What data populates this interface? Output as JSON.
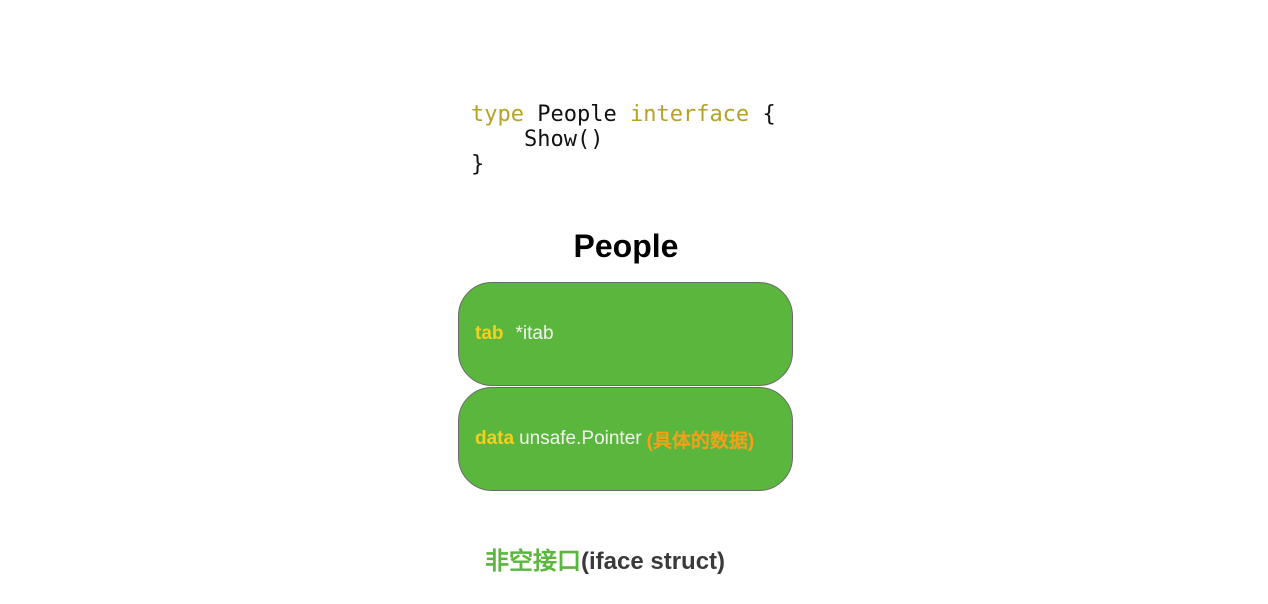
{
  "code": {
    "line1": {
      "kw1": "type",
      "name": "People",
      "kw2": "interface",
      "brace": "{"
    },
    "line2": {
      "text": "Show()"
    },
    "line3": {
      "text": "}"
    }
  },
  "struct": {
    "title": "People",
    "fields": [
      {
        "name": "tab",
        "type": "*itab",
        "note": ""
      },
      {
        "name": "data",
        "type": "unsafe.Pointer",
        "note": "(具体的数据)"
      }
    ]
  },
  "caption": {
    "chinese": "非空接口",
    "english": "(iface struct)"
  },
  "colors": {
    "keyword": "#b5a227",
    "box_fill": "#5bb63e",
    "field_name": "#f5cf1e",
    "field_type": "#f2f5ee",
    "note": "#f5a01a",
    "caption_cn": "#5bb63e",
    "caption_en": "#3a3a3a"
  }
}
